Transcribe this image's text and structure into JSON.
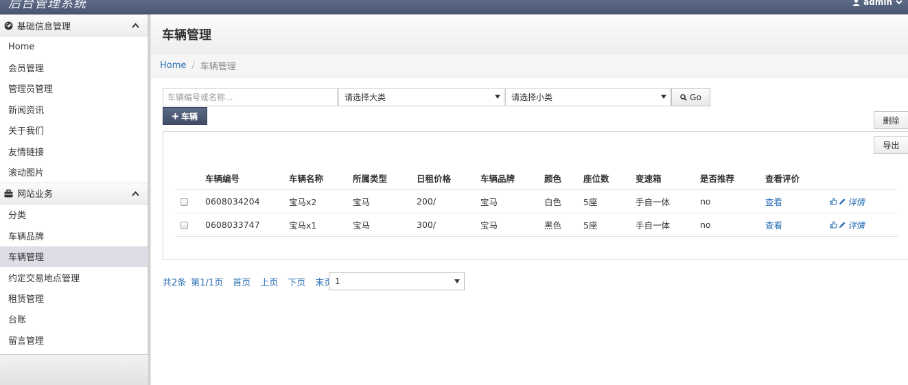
{
  "app": {
    "title": "后台管理系统",
    "user": "admin"
  },
  "sidebar": {
    "groups": [
      {
        "label": "基础信息管理",
        "items": [
          "Home",
          "会员管理",
          "管理员管理",
          "新闻资讯",
          "关于我们",
          "友情链接",
          "滚动图片"
        ]
      },
      {
        "label": "网站业务",
        "items": [
          "分类",
          "车辆品牌",
          "车辆管理",
          "约定交易地点管理",
          "租赁管理",
          "台账",
          "留言管理"
        ]
      }
    ],
    "active_item": "车辆管理"
  },
  "page": {
    "title": "车辆管理",
    "breadcrumb": {
      "home": "Home",
      "current": "车辆管理"
    }
  },
  "toolbar": {
    "search_placeholder": "车辆编号或名称...",
    "category_select": "请选择大类",
    "subcategory_select": "请选择小类",
    "go_label": "Go",
    "add_label": "车辆",
    "delete_label": "删除",
    "export_label": "导出"
  },
  "table": {
    "columns": [
      "车辆编号",
      "车辆名称",
      "所属类型",
      "日租价格",
      "车辆品牌",
      "颜色",
      "座位数",
      "变速箱",
      "是否推荐",
      "查看评价"
    ],
    "rows": [
      {
        "id": "0608034204",
        "name": "宝马x2",
        "type": "宝马",
        "price": "200/",
        "brand": "宝马",
        "color": "白色",
        "seats": "5座",
        "gearbox": "手自一体",
        "recommend": "no",
        "review": "查看",
        "detail": "详情"
      },
      {
        "id": "0608033747",
        "name": "宝马x1",
        "type": "宝马",
        "price": "300/",
        "brand": "宝马",
        "color": "黑色",
        "seats": "5座",
        "gearbox": "手自一体",
        "recommend": "no",
        "review": "查看",
        "detail": "详情"
      }
    ]
  },
  "pager": {
    "total": "共2条",
    "page_info": "第1/1页",
    "first": "首页",
    "prev": "上页",
    "next": "下页",
    "last": "末页",
    "page_select": "1"
  },
  "colors": {
    "topbar": "#4f5b77",
    "link": "#2a6fb5",
    "add_button": "#4a5672",
    "active_nav": "#dddde6"
  }
}
